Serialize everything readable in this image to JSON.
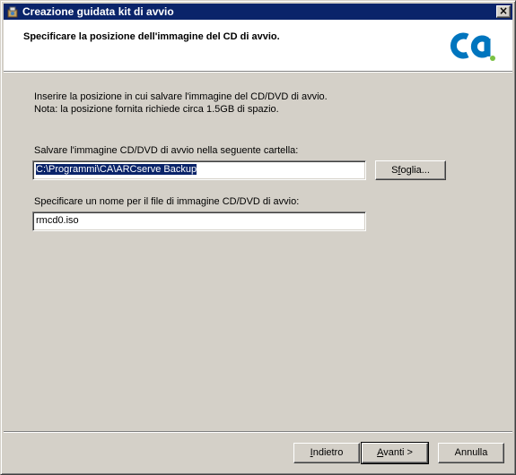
{
  "window": {
    "title": "Creazione guidata kit di avvio",
    "close_label": "×"
  },
  "header": {
    "title": "Specificare la posizione dell'immagine del CD di avvio."
  },
  "instructions": {
    "line1": "Inserire la posizione in cui salvare l'immagine del CD/DVD di avvio.",
    "line2": "Nota: la posizione fornita richiede circa 1.5GB di spazio."
  },
  "folder": {
    "label": "Salvare l'immagine CD/DVD di avvio nella seguente cartella:",
    "value": "C:\\Programmi\\CA\\ARCserve Backup",
    "browse_label_pre": "S",
    "browse_label_u": "f",
    "browse_label_post": "oglia..."
  },
  "filename": {
    "label": "Specificare un nome per il file di immagine CD/DVD di avvio:",
    "value": "rmcd0.iso"
  },
  "buttons": {
    "back_pre": "",
    "back_u": "I",
    "back_post": "ndietro",
    "next_pre": "",
    "next_u": "A",
    "next_post": "vanti >",
    "cancel": "Annulla"
  },
  "colors": {
    "titlebar": "#0a246a",
    "logo_blue": "#0075be",
    "logo_green": "#7ac143"
  },
  "icons": {
    "title_icon": "wizard-app-icon",
    "logo": "ca-logo"
  }
}
